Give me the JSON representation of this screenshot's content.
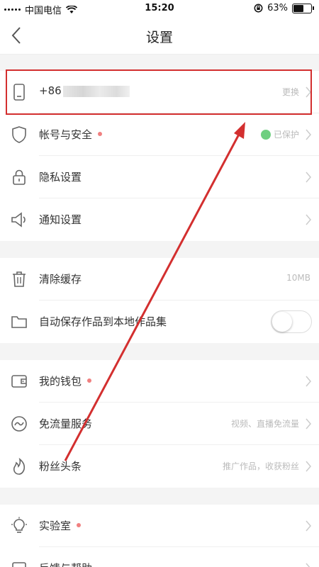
{
  "status_bar": {
    "carrier": "中国电信",
    "time": "15:20",
    "battery": "63%",
    "battery_level": 0.63
  },
  "nav": {
    "title": "设置"
  },
  "sections": [
    {
      "rows": [
        {
          "label": "+86",
          "value": "更换",
          "icon": "phone-icon"
        },
        {
          "label": "帐号与安全",
          "value": "已保护",
          "icon": "shield-icon",
          "dot": true
        },
        {
          "label": "隐私设置",
          "icon": "lock-icon"
        },
        {
          "label": "通知设置",
          "icon": "speaker-icon"
        }
      ]
    },
    {
      "rows": [
        {
          "label": "清除缓存",
          "value": "10MB",
          "icon": "trash-icon"
        },
        {
          "label": "自动保存作品到本地作品集",
          "icon": "folder-icon",
          "toggle": false
        }
      ]
    },
    {
      "rows": [
        {
          "label": "我的钱包",
          "icon": "wallet-icon",
          "dot": true
        },
        {
          "label": "免流量服务",
          "value": "视频、直播免流量",
          "icon": "wave-icon"
        },
        {
          "label": "粉丝头条",
          "value": "推广作品，收获粉丝",
          "icon": "flame-icon"
        }
      ]
    },
    {
      "rows": [
        {
          "label": "实验室",
          "icon": "bulb-icon",
          "dot": true
        },
        {
          "label": "反馈与帮助",
          "icon": "feedback-icon"
        }
      ]
    }
  ],
  "colors": {
    "annotation_red": "#d32f2f",
    "dot_pink": "#f08080",
    "protect_green": "#6fcf80"
  }
}
